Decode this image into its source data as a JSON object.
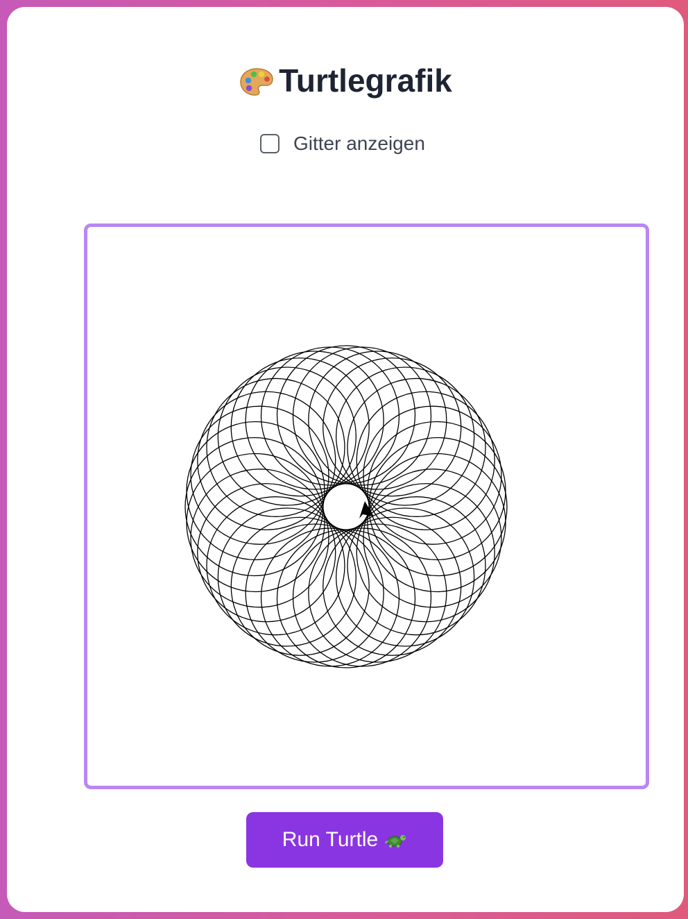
{
  "app": {
    "title": "Turtlegrafik",
    "title_icon": "palette-icon"
  },
  "controls": {
    "grid_checkbox_label": "Gitter anzeigen",
    "grid_checked": false,
    "run_button_label": "Run Turtle",
    "run_button_icon": "turtle-icon"
  },
  "colors": {
    "background_gradient_start": "#c55ab8",
    "background_gradient_end": "#e05a7c",
    "canvas_border": "#b987f2",
    "button": "#8a35e2",
    "title_text": "#1e2433",
    "drawing_stroke": "#000000"
  },
  "drawing": {
    "pattern": "circle rosette",
    "circle_count": 36,
    "turtle_heading_icon": "arrow-cursor-icon"
  }
}
